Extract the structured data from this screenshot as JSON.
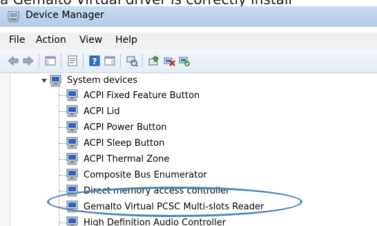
{
  "caption": {
    "text": "a Gemalto Virtual driver is correctly install"
  },
  "window": {
    "title": "Device Manager",
    "title_icon": "device-manager-icon"
  },
  "menu": {
    "items": [
      "File",
      "Action",
      "View",
      "Help"
    ]
  },
  "toolbar": {
    "icons": [
      "back-arrow-icon",
      "forward-arrow-icon",
      "show-hide-console-tree-icon",
      "properties-icon",
      "help-icon",
      "show-action-pane-icon",
      "scan-hardware-changes-icon",
      "update-driver-icon",
      "uninstall-device-icon",
      "enable-device-icon"
    ]
  },
  "tree": {
    "category": {
      "label": "System devices",
      "expanded": true,
      "icon": "system-devices-icon"
    },
    "devices": [
      "ACPI Fixed Feature Button",
      "ACPI Lid",
      "ACPI Power Button",
      "ACPI Sleep Button",
      "ACPI Thermal Zone",
      "Composite Bus Enumerator",
      "Direct memory access controller",
      "Gemalto Virtual PCSC Multi-slots Reader",
      "High Definition Audio Controller"
    ],
    "highlighted_device": "Gemalto Virtual PCSC Multi-slots Reader",
    "highlight_color": "#4a84c4"
  }
}
